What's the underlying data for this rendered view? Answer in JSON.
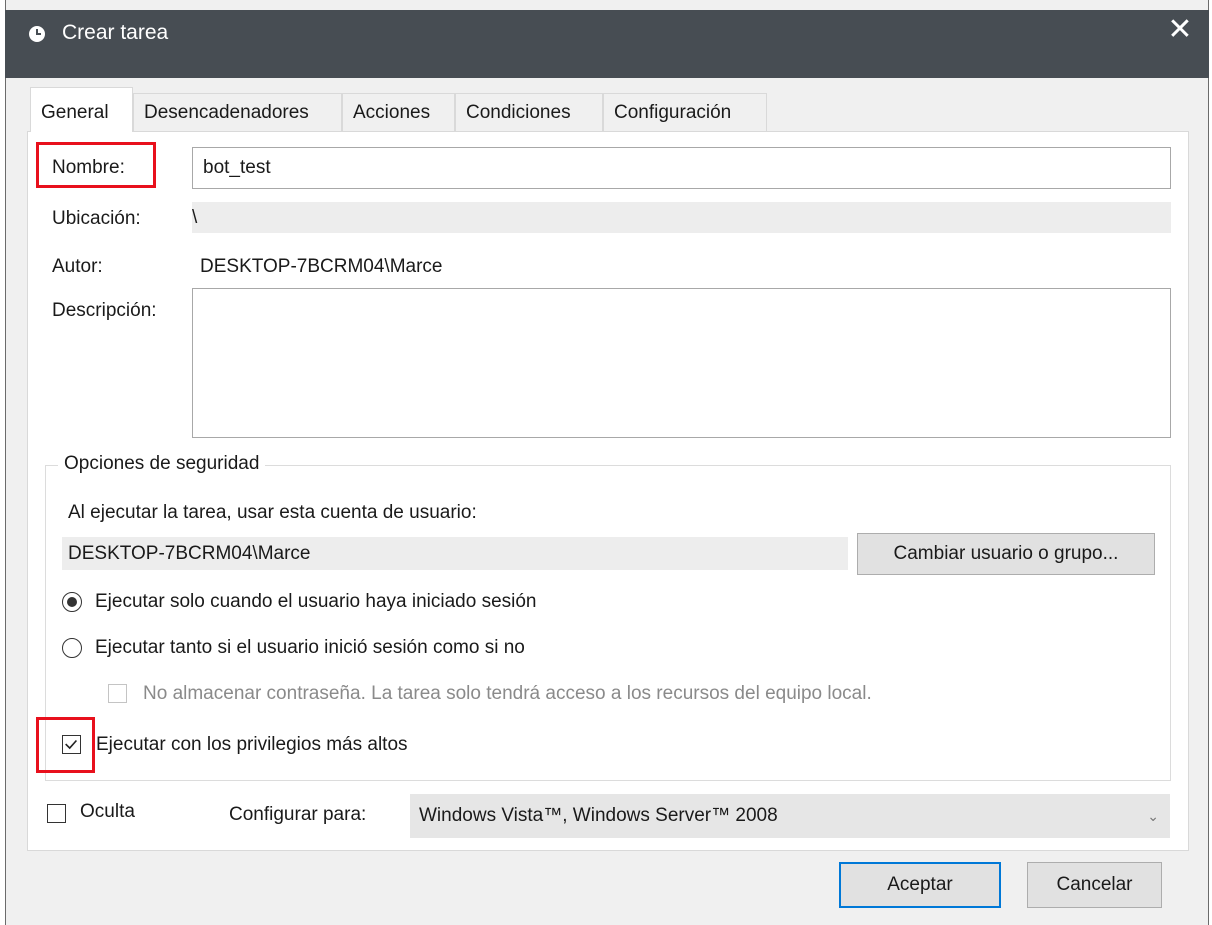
{
  "window": {
    "title": "Crear tarea",
    "close_icon": "close-icon"
  },
  "tabs": [
    "General",
    "Desencadenadores",
    "Acciones",
    "Condiciones",
    "Configuración"
  ],
  "general": {
    "name_label": "Nombre:",
    "name_value": "bot_test",
    "location_label": "Ubicación:",
    "location_value": "\\",
    "author_label": "Autor:",
    "author_value": "DESKTOP-7BCRM04\\Marce",
    "description_label": "Descripción:",
    "description_value": ""
  },
  "security": {
    "group_title": "Opciones de seguridad",
    "account_prompt": "Al ejecutar la tarea, usar esta cuenta de usuario:",
    "account_value": "DESKTOP-7BCRM04\\Marce",
    "change_user_button": "Cambiar usuario o grupo...",
    "radio_logged_on": "Ejecutar solo cuando el usuario haya iniciado sesión",
    "radio_logged_on_checked": true,
    "radio_any": "Ejecutar tanto si el usuario inició sesión como si no",
    "radio_any_checked": false,
    "no_store_password": "No almacenar contraseña. La tarea solo tendrá acceso a los recursos del equipo local.",
    "no_store_password_checked": false,
    "highest_privileges": "Ejecutar con los privilegios más altos",
    "highest_privileges_checked": true
  },
  "bottom": {
    "hidden_label": "Oculta",
    "hidden_checked": false,
    "configure_for_label": "Configurar para:",
    "configure_for_value": "Windows Vista™, Windows Server™ 2008"
  },
  "buttons": {
    "ok": "Aceptar",
    "cancel": "Cancelar"
  },
  "colors": {
    "titlebar": "#474d53",
    "highlight": "#e8101c",
    "accent": "#0078d7"
  }
}
